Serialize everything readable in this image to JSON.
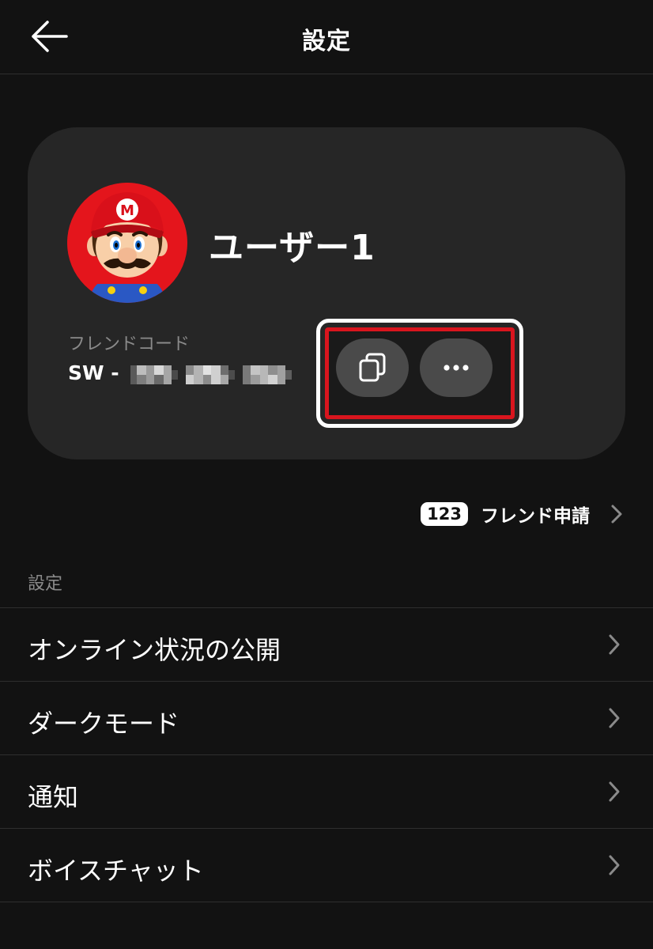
{
  "header": {
    "title": "設定",
    "back_icon": "arrow-left-icon"
  },
  "profile": {
    "username": "ユーザー1",
    "friend_code_label": "フレンドコード",
    "friend_code_prefix": "SW -",
    "avatar_icon": "mario-avatar",
    "copy_icon": "copy-icon",
    "more_icon": "more-horizontal-icon"
  },
  "friend_request": {
    "count": "123",
    "label": "フレンド申請",
    "chevron_icon": "chevron-right-icon"
  },
  "settings": {
    "section_title": "設定",
    "items": [
      {
        "label": "オンライン状況の公開"
      },
      {
        "label": "ダークモード"
      },
      {
        "label": "通知"
      },
      {
        "label": "ボイスチャット"
      }
    ]
  },
  "colors": {
    "background": "#121212",
    "card": "#262626",
    "highlight_red": "#d9151e",
    "button": "#4a4a4a",
    "secondary_text": "#8a8a8a"
  }
}
